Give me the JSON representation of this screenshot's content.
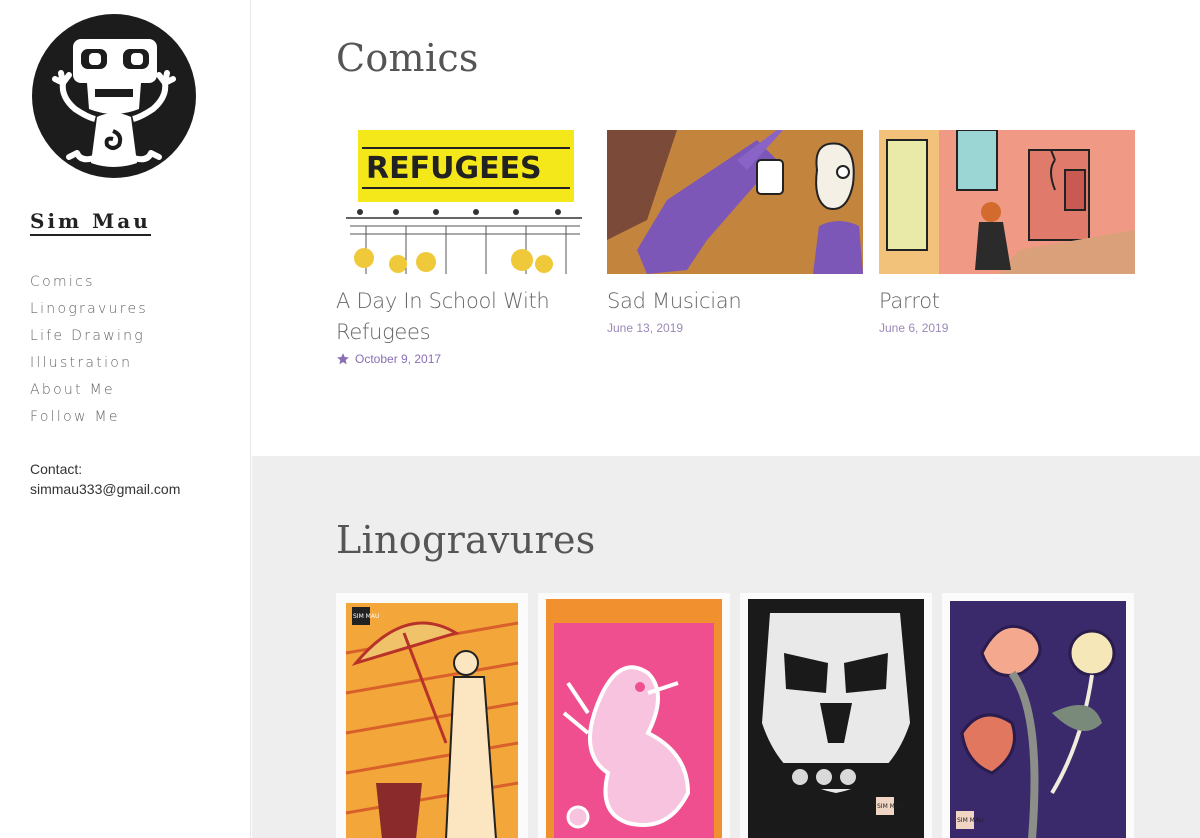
{
  "site": {
    "title": "Sim Mau"
  },
  "nav": {
    "items": [
      {
        "label": "Comics"
      },
      {
        "label": "Linogravures"
      },
      {
        "label": "Life Drawing"
      },
      {
        "label": "Illustration"
      },
      {
        "label": "About Me"
      },
      {
        "label": "Follow Me"
      }
    ]
  },
  "contact": {
    "label": "Contact:",
    "email": "simmau333@gmail.com"
  },
  "comics": {
    "heading": "Comics",
    "posts": [
      {
        "title": "A Day In School With Refugees",
        "date": "October 9, 2017",
        "sticky": true,
        "thumb_text": "REFUGEES"
      },
      {
        "title": "Sad Musician",
        "date": "June 13, 2019",
        "sticky": false
      },
      {
        "title": "Parrot",
        "date": "June 6, 2019",
        "sticky": false
      }
    ]
  },
  "linogravures": {
    "heading": "Linogravures",
    "prints": [
      {
        "name": "umbrella-woman-print",
        "stamp": "SIM MAU"
      },
      {
        "name": "pink-bird-print",
        "stamp": ""
      },
      {
        "name": "mask-print",
        "stamp": "SIM MAU"
      },
      {
        "name": "flowers-print",
        "stamp": "SIM MAU"
      }
    ]
  },
  "colors": {
    "accent": "#8a6fb5",
    "text": "#555555",
    "section_bg": "#eeeeee"
  }
}
